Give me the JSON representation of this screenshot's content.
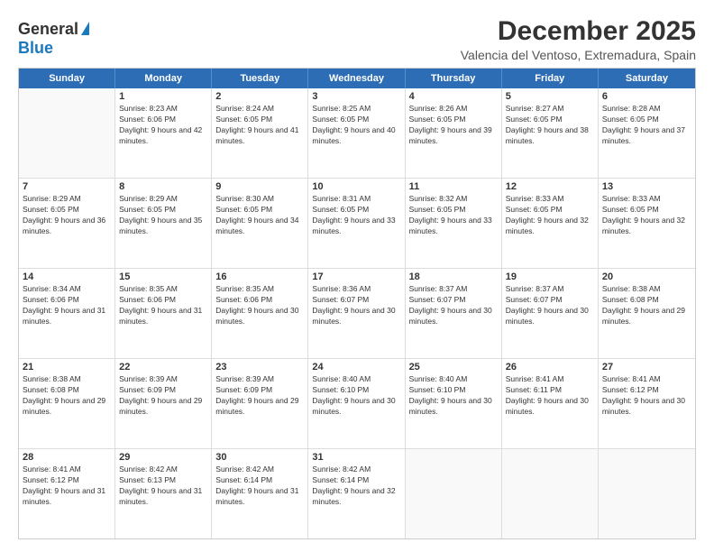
{
  "logo": {
    "general": "General",
    "blue": "Blue"
  },
  "title": "December 2025",
  "subtitle": "Valencia del Ventoso, Extremadura, Spain",
  "header_days": [
    "Sunday",
    "Monday",
    "Tuesday",
    "Wednesday",
    "Thursday",
    "Friday",
    "Saturday"
  ],
  "rows": [
    [
      {
        "date": "",
        "empty": true
      },
      {
        "date": "1",
        "sunrise": "Sunrise: 8:23 AM",
        "sunset": "Sunset: 6:06 PM",
        "daylight": "Daylight: 9 hours and 42 minutes."
      },
      {
        "date": "2",
        "sunrise": "Sunrise: 8:24 AM",
        "sunset": "Sunset: 6:05 PM",
        "daylight": "Daylight: 9 hours and 41 minutes."
      },
      {
        "date": "3",
        "sunrise": "Sunrise: 8:25 AM",
        "sunset": "Sunset: 6:05 PM",
        "daylight": "Daylight: 9 hours and 40 minutes."
      },
      {
        "date": "4",
        "sunrise": "Sunrise: 8:26 AM",
        "sunset": "Sunset: 6:05 PM",
        "daylight": "Daylight: 9 hours and 39 minutes."
      },
      {
        "date": "5",
        "sunrise": "Sunrise: 8:27 AM",
        "sunset": "Sunset: 6:05 PM",
        "daylight": "Daylight: 9 hours and 38 minutes."
      },
      {
        "date": "6",
        "sunrise": "Sunrise: 8:28 AM",
        "sunset": "Sunset: 6:05 PM",
        "daylight": "Daylight: 9 hours and 37 minutes."
      }
    ],
    [
      {
        "date": "7",
        "sunrise": "Sunrise: 8:29 AM",
        "sunset": "Sunset: 6:05 PM",
        "daylight": "Daylight: 9 hours and 36 minutes."
      },
      {
        "date": "8",
        "sunrise": "Sunrise: 8:29 AM",
        "sunset": "Sunset: 6:05 PM",
        "daylight": "Daylight: 9 hours and 35 minutes."
      },
      {
        "date": "9",
        "sunrise": "Sunrise: 8:30 AM",
        "sunset": "Sunset: 6:05 PM",
        "daylight": "Daylight: 9 hours and 34 minutes."
      },
      {
        "date": "10",
        "sunrise": "Sunrise: 8:31 AM",
        "sunset": "Sunset: 6:05 PM",
        "daylight": "Daylight: 9 hours and 33 minutes."
      },
      {
        "date": "11",
        "sunrise": "Sunrise: 8:32 AM",
        "sunset": "Sunset: 6:05 PM",
        "daylight": "Daylight: 9 hours and 33 minutes."
      },
      {
        "date": "12",
        "sunrise": "Sunrise: 8:33 AM",
        "sunset": "Sunset: 6:05 PM",
        "daylight": "Daylight: 9 hours and 32 minutes."
      },
      {
        "date": "13",
        "sunrise": "Sunrise: 8:33 AM",
        "sunset": "Sunset: 6:05 PM",
        "daylight": "Daylight: 9 hours and 32 minutes."
      }
    ],
    [
      {
        "date": "14",
        "sunrise": "Sunrise: 8:34 AM",
        "sunset": "Sunset: 6:06 PM",
        "daylight": "Daylight: 9 hours and 31 minutes."
      },
      {
        "date": "15",
        "sunrise": "Sunrise: 8:35 AM",
        "sunset": "Sunset: 6:06 PM",
        "daylight": "Daylight: 9 hours and 31 minutes."
      },
      {
        "date": "16",
        "sunrise": "Sunrise: 8:35 AM",
        "sunset": "Sunset: 6:06 PM",
        "daylight": "Daylight: 9 hours and 30 minutes."
      },
      {
        "date": "17",
        "sunrise": "Sunrise: 8:36 AM",
        "sunset": "Sunset: 6:07 PM",
        "daylight": "Daylight: 9 hours and 30 minutes."
      },
      {
        "date": "18",
        "sunrise": "Sunrise: 8:37 AM",
        "sunset": "Sunset: 6:07 PM",
        "daylight": "Daylight: 9 hours and 30 minutes."
      },
      {
        "date": "19",
        "sunrise": "Sunrise: 8:37 AM",
        "sunset": "Sunset: 6:07 PM",
        "daylight": "Daylight: 9 hours and 30 minutes."
      },
      {
        "date": "20",
        "sunrise": "Sunrise: 8:38 AM",
        "sunset": "Sunset: 6:08 PM",
        "daylight": "Daylight: 9 hours and 29 minutes."
      }
    ],
    [
      {
        "date": "21",
        "sunrise": "Sunrise: 8:38 AM",
        "sunset": "Sunset: 6:08 PM",
        "daylight": "Daylight: 9 hours and 29 minutes."
      },
      {
        "date": "22",
        "sunrise": "Sunrise: 8:39 AM",
        "sunset": "Sunset: 6:09 PM",
        "daylight": "Daylight: 9 hours and 29 minutes."
      },
      {
        "date": "23",
        "sunrise": "Sunrise: 8:39 AM",
        "sunset": "Sunset: 6:09 PM",
        "daylight": "Daylight: 9 hours and 29 minutes."
      },
      {
        "date": "24",
        "sunrise": "Sunrise: 8:40 AM",
        "sunset": "Sunset: 6:10 PM",
        "daylight": "Daylight: 9 hours and 30 minutes."
      },
      {
        "date": "25",
        "sunrise": "Sunrise: 8:40 AM",
        "sunset": "Sunset: 6:10 PM",
        "daylight": "Daylight: 9 hours and 30 minutes."
      },
      {
        "date": "26",
        "sunrise": "Sunrise: 8:41 AM",
        "sunset": "Sunset: 6:11 PM",
        "daylight": "Daylight: 9 hours and 30 minutes."
      },
      {
        "date": "27",
        "sunrise": "Sunrise: 8:41 AM",
        "sunset": "Sunset: 6:12 PM",
        "daylight": "Daylight: 9 hours and 30 minutes."
      }
    ],
    [
      {
        "date": "28",
        "sunrise": "Sunrise: 8:41 AM",
        "sunset": "Sunset: 6:12 PM",
        "daylight": "Daylight: 9 hours and 31 minutes."
      },
      {
        "date": "29",
        "sunrise": "Sunrise: 8:42 AM",
        "sunset": "Sunset: 6:13 PM",
        "daylight": "Daylight: 9 hours and 31 minutes."
      },
      {
        "date": "30",
        "sunrise": "Sunrise: 8:42 AM",
        "sunset": "Sunset: 6:14 PM",
        "daylight": "Daylight: 9 hours and 31 minutes."
      },
      {
        "date": "31",
        "sunrise": "Sunrise: 8:42 AM",
        "sunset": "Sunset: 6:14 PM",
        "daylight": "Daylight: 9 hours and 32 minutes."
      },
      {
        "date": "",
        "empty": true
      },
      {
        "date": "",
        "empty": true
      },
      {
        "date": "",
        "empty": true
      }
    ]
  ]
}
